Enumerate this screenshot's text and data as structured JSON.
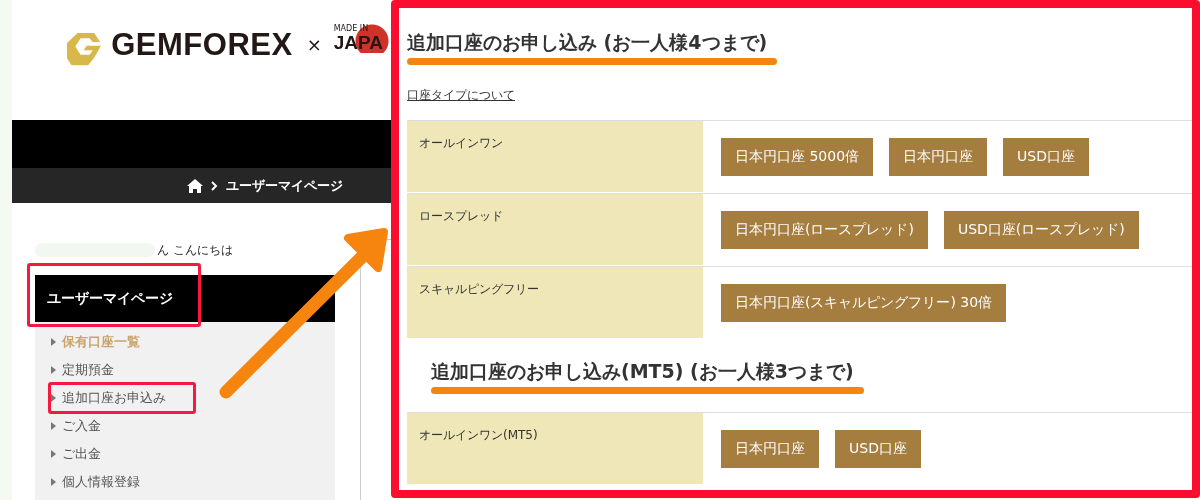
{
  "header": {
    "logo_text": "GEMFOREX",
    "separator": "×",
    "badge_top": "MADE IN",
    "badge_bottom": "JAPA"
  },
  "breadcrumb": {
    "current": "ユーザーマイページ"
  },
  "greeting": "ん こんにちは",
  "sidebar": {
    "title": "ユーザーマイページ",
    "title_highlighted": true,
    "items": [
      {
        "label": "保有口座一覧",
        "selected": true,
        "highlighted": false
      },
      {
        "label": "定期預金",
        "selected": false,
        "highlighted": false
      },
      {
        "label": "追加口座お申込み",
        "selected": false,
        "highlighted": true
      },
      {
        "label": "ご入金",
        "selected": false,
        "highlighted": false
      },
      {
        "label": "ご出金",
        "selected": false,
        "highlighted": false
      },
      {
        "label": "個人情報登録",
        "selected": false,
        "highlighted": false
      }
    ]
  },
  "sections": [
    {
      "title": "追加口座のお申し込み (お一人様4つまで)",
      "link": "口座タイプについて",
      "rows": [
        {
          "label": "オールインワン",
          "buttons": [
            "日本円口座 5000倍",
            "日本円口座",
            "USD口座"
          ]
        },
        {
          "label": "ロースプレッド",
          "buttons": [
            "日本円口座(ロースプレッド)",
            "USD口座(ロースプレッド)"
          ]
        },
        {
          "label": "スキャルピングフリー",
          "buttons": [
            "日本円口座(スキャルピングフリー) 30倍"
          ]
        }
      ]
    },
    {
      "title": "追加口座のお申し込み(MT5) (お一人様3つまで)",
      "rows": [
        {
          "label": "オールインワン(MT5)",
          "buttons": [
            "日本円口座",
            "USD口座"
          ]
        }
      ]
    }
  ]
}
